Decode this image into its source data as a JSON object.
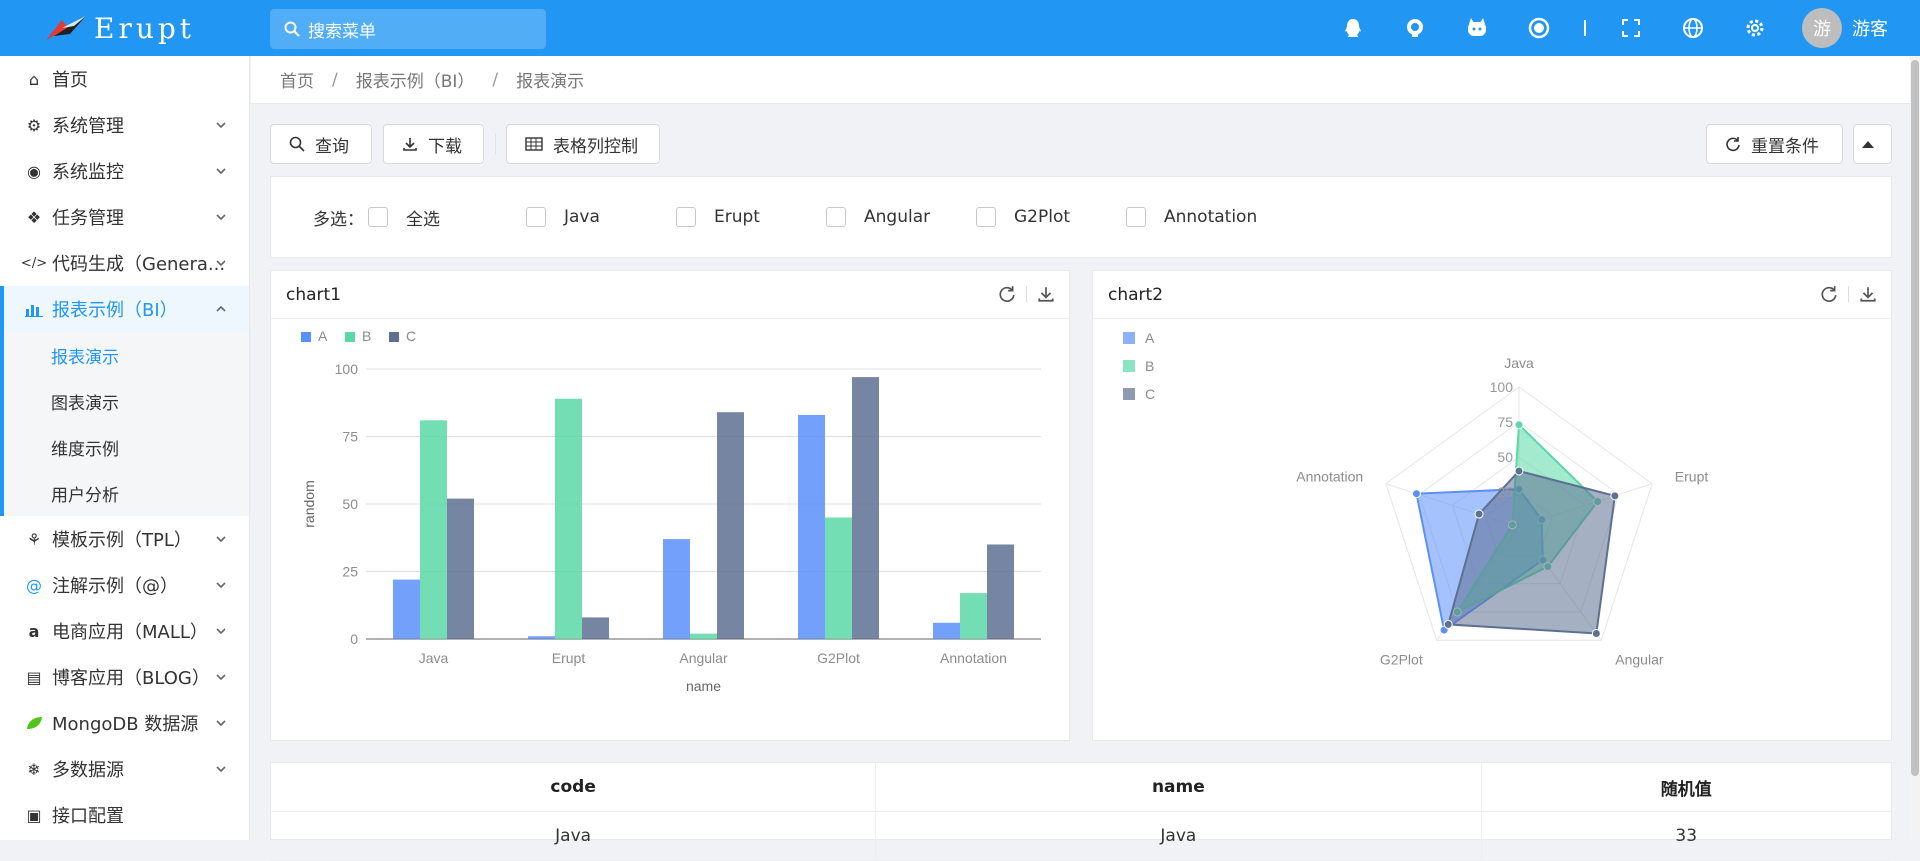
{
  "app": {
    "title": "Erupt"
  },
  "search": {
    "placeholder": "搜索菜单"
  },
  "header": {
    "icons": [
      "qq-icon",
      "github-icon",
      "gitee-icon",
      "record-icon",
      "fullscreen-icon",
      "globe-icon",
      "gear-icon"
    ],
    "avatar_char": "游",
    "username": "游客"
  },
  "sidebar": {
    "items": [
      {
        "label": "首页",
        "icon": "home-icon"
      },
      {
        "label": "系统管理",
        "icon": "gears-icon"
      },
      {
        "label": "系统监控",
        "icon": "monitor-icon"
      },
      {
        "label": "任务管理",
        "icon": "cubes-icon"
      },
      {
        "label": "代码生成（Genera...",
        "icon": "code-icon"
      },
      {
        "label": "报表示例（BI）",
        "icon": "bar-chart-icon"
      }
    ],
    "subitems": [
      "报表演示",
      "图表演示",
      "维度示例",
      "用户分析"
    ],
    "items2": [
      {
        "label": "模板示例（TPL）",
        "icon": "puzzle-icon"
      },
      {
        "label": "注解示例（@）",
        "icon": "at-icon"
      },
      {
        "label": "电商应用（MALL）",
        "icon": "amazon-icon"
      },
      {
        "label": "博客应用（BLOG）",
        "icon": "document-icon"
      },
      {
        "label": "MongoDB 数据源",
        "icon": "leaf-icon"
      },
      {
        "label": "多数据源",
        "icon": "snowflake-icon"
      },
      {
        "label": "接口配置",
        "icon": "window-icon"
      }
    ]
  },
  "breadcrumb": [
    "首页",
    "报表示例（BI）",
    "报表演示"
  ],
  "toolbar": {
    "query": "查询",
    "download": "下载",
    "columns": "表格列控制",
    "reset": "重置条件"
  },
  "filter": {
    "label": "多选：",
    "options": [
      "全选",
      "Java",
      "Erupt",
      "Angular",
      "G2Plot",
      "Annotation"
    ]
  },
  "colors": {
    "A": "#5b8ff9",
    "B": "#5ad8a6",
    "C": "#5d7092",
    "primary": "#2196f3"
  },
  "chart1": {
    "title": "chart1"
  },
  "chart2": {
    "title": "chart2"
  },
  "chart_data": [
    {
      "type": "bar",
      "title": "chart1",
      "xlabel": "name",
      "ylabel": "random",
      "categories": [
        "Java",
        "Erupt",
        "Angular",
        "G2Plot",
        "Annotation"
      ],
      "series": [
        {
          "name": "A",
          "values": [
            22,
            1,
            37,
            83,
            6
          ]
        },
        {
          "name": "B",
          "values": [
            81,
            89,
            2,
            45,
            17
          ]
        },
        {
          "name": "C",
          "values": [
            52,
            8,
            84,
            97,
            35
          ]
        }
      ],
      "ylim": [
        0,
        100
      ],
      "yticks": [
        0,
        25,
        50,
        75,
        100
      ],
      "legend": "top-left",
      "grid": true
    },
    {
      "type": "radar",
      "title": "chart2",
      "categories": [
        "Java",
        "Erupt",
        "Angular",
        "G2Plot",
        "Annotation"
      ],
      "series": [
        {
          "name": "A",
          "values": [
            27,
            17,
            29,
            91,
            77
          ]
        },
        {
          "name": "B",
          "values": [
            73,
            59,
            35,
            75,
            5
          ]
        },
        {
          "name": "C",
          "values": [
            40,
            72,
            94,
            86,
            30
          ]
        }
      ],
      "range": [
        0,
        100
      ],
      "ticks": [
        25,
        50,
        75,
        100
      ],
      "legend": "top-left"
    }
  ],
  "table": {
    "columns": [
      "code",
      "name",
      "随机值"
    ],
    "rows": [
      [
        "Java",
        "Java",
        "33"
      ]
    ]
  }
}
